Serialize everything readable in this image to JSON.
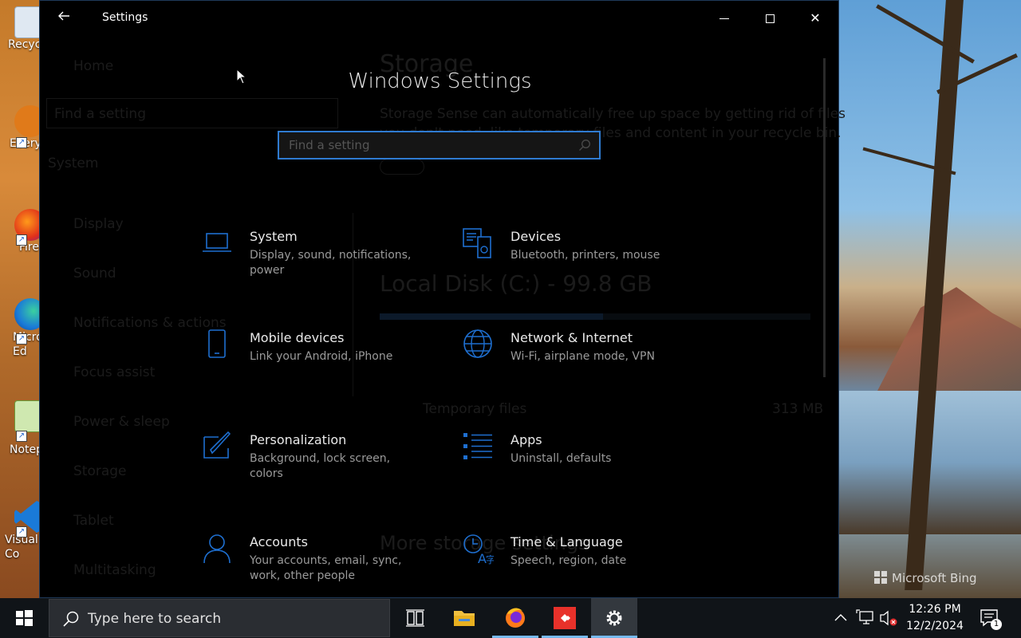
{
  "window": {
    "title": "Settings",
    "back": "←",
    "close": "✕"
  },
  "home": {
    "heading": "Windows Settings",
    "search_placeholder": "Find a setting"
  },
  "tiles": [
    {
      "name": "System",
      "desc": "Display, sound, notifications, power",
      "icon": "laptop-icon"
    },
    {
      "name": "Devices",
      "desc": "Bluetooth, printers, mouse",
      "icon": "devices-icon"
    },
    {
      "name": "Mobile devices",
      "desc": "Link your Android, iPhone",
      "icon": "phone-icon"
    },
    {
      "name": "Network & Internet",
      "desc": "Wi-Fi, airplane mode, VPN",
      "icon": "globe-icon"
    },
    {
      "name": "Personalization",
      "desc": "Background, lock screen, colors",
      "icon": "paintbrush-icon"
    },
    {
      "name": "Apps",
      "desc": "Uninstall, defaults",
      "icon": "apps-list-icon"
    },
    {
      "name": "Accounts",
      "desc": "Your accounts, email, sync, work, other people",
      "icon": "person-icon"
    },
    {
      "name": "Time & Language",
      "desc": "Speech, region, date",
      "icon": "time-language-icon"
    }
  ],
  "background_page": {
    "title": "Storage",
    "nav_home": "Home",
    "nav_find": "Find a setting",
    "nav_section": "System",
    "nav_items": [
      "Display",
      "Sound",
      "Notifications & actions",
      "Focus assist",
      "Power & sleep",
      "Storage",
      "Tablet",
      "Multitasking"
    ],
    "desc_line1": "Storage Sense can automatically free up space by getting rid of files",
    "desc_line2": "you don't need, like temporary files and content in your recycle bin.",
    "disk_label": "Local Disk (C:) - 99.8 GB",
    "temp_files": "Temporary files",
    "temp_size": "313 MB",
    "more_storage": "More storage settings"
  },
  "desktop": {
    "icons": [
      "Recycle Bin",
      "Everything",
      "Firefox",
      "Microsoft Edge",
      "Notepad++",
      "Visual Studio Code"
    ],
    "icon_labels": [
      "Recyc",
      "Every",
      "Fire",
      "Micro\nEd",
      "Notep",
      "Visual\nCo"
    ],
    "watermark": "Microsoft Bing"
  },
  "taskbar": {
    "search_text": "Type here to search",
    "time": "12:26 PM",
    "date": "12/2/2024",
    "notification_count": "1"
  },
  "colors": {
    "accent": "#2f7bd1",
    "icon_blue": "#1e6fd0",
    "window_bg": "#000000",
    "taskbar_bg": "#101418"
  }
}
